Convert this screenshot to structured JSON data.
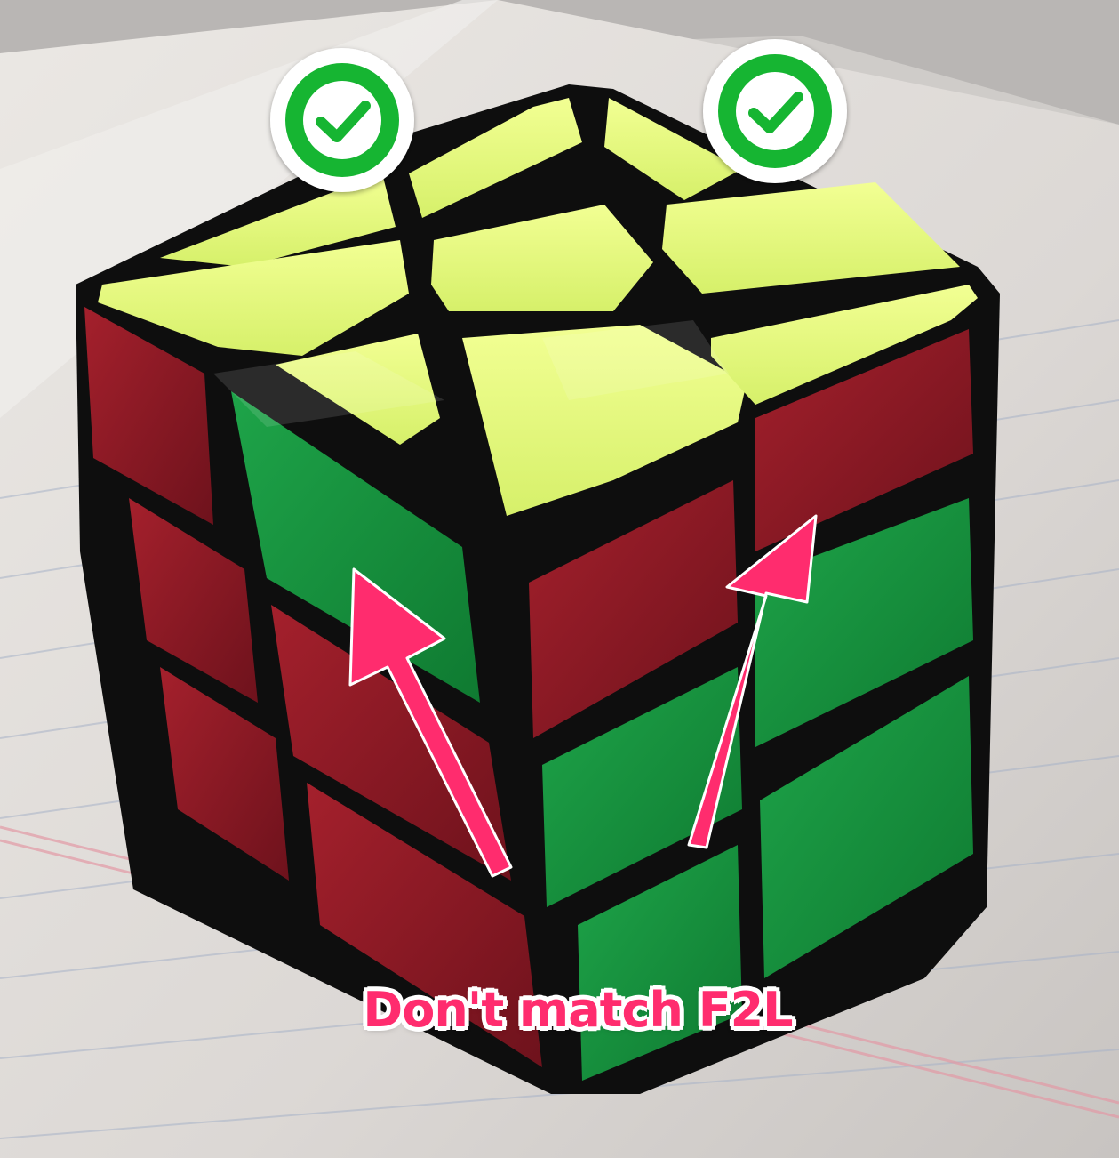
{
  "annotation": {
    "label": "Don't match F2L",
    "label_color": "#ff2c6e",
    "arrow_color": "#ff2c6e",
    "check_badge_color": "#16b532",
    "check_badges": [
      {
        "name": "check-badge-left",
        "icon": "checkmark-icon"
      },
      {
        "name": "check-badge-right",
        "icon": "checkmark-icon"
      }
    ]
  },
  "cube": {
    "top_color": "#d8f26e",
    "front_colors": [
      "#168c3a",
      "#8e1620",
      "#5e1220"
    ],
    "right_colors": [
      "#8e1620",
      "#168c3a"
    ]
  }
}
